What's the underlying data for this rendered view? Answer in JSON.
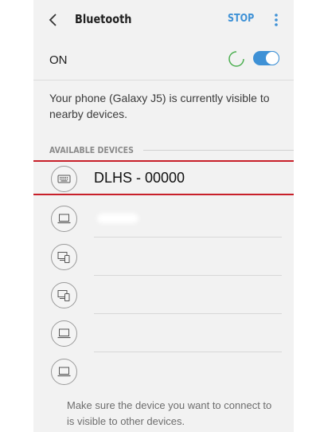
{
  "header": {
    "title": "Bluetooth",
    "stop_label": "STOP",
    "back_icon": "chevron-left-icon",
    "more_icon": "more-vertical-icon"
  },
  "bluetooth": {
    "status_label": "ON",
    "toggle_on": true,
    "scanning": true
  },
  "visibility_message": "Your phone (Galaxy J5) is currently visible to nearby devices.",
  "available_devices": {
    "section_title": "AVAILABLE DEVICES",
    "items": [
      {
        "name": "DLHS - 00000",
        "icon": "keyboard-icon",
        "highlighted": true
      },
      {
        "name": "",
        "icon": "laptop-icon"
      },
      {
        "name": "",
        "icon": "computer-phone-icon"
      },
      {
        "name": "",
        "icon": "computer-phone-icon"
      },
      {
        "name": "",
        "icon": "laptop-icon"
      },
      {
        "name": "",
        "icon": "laptop-icon"
      }
    ]
  },
  "footer_message": "Make sure the device you want to connect to is visible to other devices.",
  "colors": {
    "accent": "#3e91d6",
    "highlight": "#c8202a",
    "background": "#f2f2f2"
  }
}
